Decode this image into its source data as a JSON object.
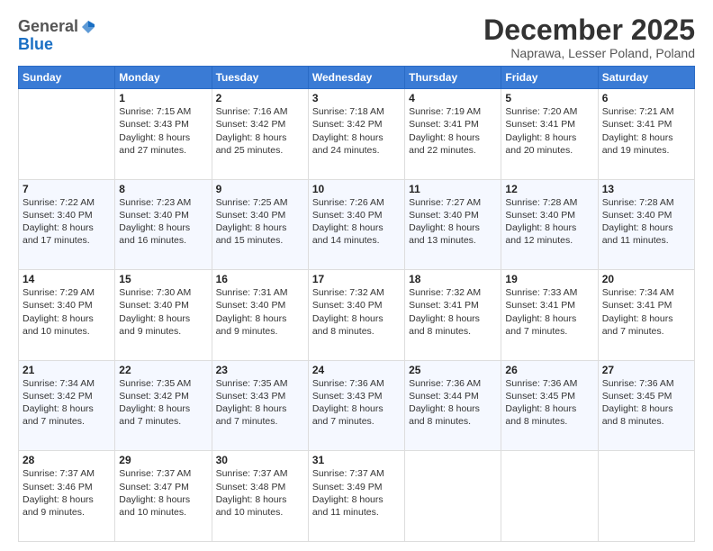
{
  "header": {
    "logo_general": "General",
    "logo_blue": "Blue",
    "month_title": "December 2025",
    "location": "Naprawa, Lesser Poland, Poland"
  },
  "weekdays": [
    "Sunday",
    "Monday",
    "Tuesday",
    "Wednesday",
    "Thursday",
    "Friday",
    "Saturday"
  ],
  "rows": [
    [
      {
        "day": "",
        "sunrise": "",
        "sunset": "",
        "daylight": ""
      },
      {
        "day": "1",
        "sunrise": "Sunrise: 7:15 AM",
        "sunset": "Sunset: 3:43 PM",
        "daylight": "Daylight: 8 hours and 27 minutes."
      },
      {
        "day": "2",
        "sunrise": "Sunrise: 7:16 AM",
        "sunset": "Sunset: 3:42 PM",
        "daylight": "Daylight: 8 hours and 25 minutes."
      },
      {
        "day": "3",
        "sunrise": "Sunrise: 7:18 AM",
        "sunset": "Sunset: 3:42 PM",
        "daylight": "Daylight: 8 hours and 24 minutes."
      },
      {
        "day": "4",
        "sunrise": "Sunrise: 7:19 AM",
        "sunset": "Sunset: 3:41 PM",
        "daylight": "Daylight: 8 hours and 22 minutes."
      },
      {
        "day": "5",
        "sunrise": "Sunrise: 7:20 AM",
        "sunset": "Sunset: 3:41 PM",
        "daylight": "Daylight: 8 hours and 20 minutes."
      },
      {
        "day": "6",
        "sunrise": "Sunrise: 7:21 AM",
        "sunset": "Sunset: 3:41 PM",
        "daylight": "Daylight: 8 hours and 19 minutes."
      }
    ],
    [
      {
        "day": "7",
        "sunrise": "Sunrise: 7:22 AM",
        "sunset": "Sunset: 3:40 PM",
        "daylight": "Daylight: 8 hours and 17 minutes."
      },
      {
        "day": "8",
        "sunrise": "Sunrise: 7:23 AM",
        "sunset": "Sunset: 3:40 PM",
        "daylight": "Daylight: 8 hours and 16 minutes."
      },
      {
        "day": "9",
        "sunrise": "Sunrise: 7:25 AM",
        "sunset": "Sunset: 3:40 PM",
        "daylight": "Daylight: 8 hours and 15 minutes."
      },
      {
        "day": "10",
        "sunrise": "Sunrise: 7:26 AM",
        "sunset": "Sunset: 3:40 PM",
        "daylight": "Daylight: 8 hours and 14 minutes."
      },
      {
        "day": "11",
        "sunrise": "Sunrise: 7:27 AM",
        "sunset": "Sunset: 3:40 PM",
        "daylight": "Daylight: 8 hours and 13 minutes."
      },
      {
        "day": "12",
        "sunrise": "Sunrise: 7:28 AM",
        "sunset": "Sunset: 3:40 PM",
        "daylight": "Daylight: 8 hours and 12 minutes."
      },
      {
        "day": "13",
        "sunrise": "Sunrise: 7:28 AM",
        "sunset": "Sunset: 3:40 PM",
        "daylight": "Daylight: 8 hours and 11 minutes."
      }
    ],
    [
      {
        "day": "14",
        "sunrise": "Sunrise: 7:29 AM",
        "sunset": "Sunset: 3:40 PM",
        "daylight": "Daylight: 8 hours and 10 minutes."
      },
      {
        "day": "15",
        "sunrise": "Sunrise: 7:30 AM",
        "sunset": "Sunset: 3:40 PM",
        "daylight": "Daylight: 8 hours and 9 minutes."
      },
      {
        "day": "16",
        "sunrise": "Sunrise: 7:31 AM",
        "sunset": "Sunset: 3:40 PM",
        "daylight": "Daylight: 8 hours and 9 minutes."
      },
      {
        "day": "17",
        "sunrise": "Sunrise: 7:32 AM",
        "sunset": "Sunset: 3:40 PM",
        "daylight": "Daylight: 8 hours and 8 minutes."
      },
      {
        "day": "18",
        "sunrise": "Sunrise: 7:32 AM",
        "sunset": "Sunset: 3:41 PM",
        "daylight": "Daylight: 8 hours and 8 minutes."
      },
      {
        "day": "19",
        "sunrise": "Sunrise: 7:33 AM",
        "sunset": "Sunset: 3:41 PM",
        "daylight": "Daylight: 8 hours and 7 minutes."
      },
      {
        "day": "20",
        "sunrise": "Sunrise: 7:34 AM",
        "sunset": "Sunset: 3:41 PM",
        "daylight": "Daylight: 8 hours and 7 minutes."
      }
    ],
    [
      {
        "day": "21",
        "sunrise": "Sunrise: 7:34 AM",
        "sunset": "Sunset: 3:42 PM",
        "daylight": "Daylight: 8 hours and 7 minutes."
      },
      {
        "day": "22",
        "sunrise": "Sunrise: 7:35 AM",
        "sunset": "Sunset: 3:42 PM",
        "daylight": "Daylight: 8 hours and 7 minutes."
      },
      {
        "day": "23",
        "sunrise": "Sunrise: 7:35 AM",
        "sunset": "Sunset: 3:43 PM",
        "daylight": "Daylight: 8 hours and 7 minutes."
      },
      {
        "day": "24",
        "sunrise": "Sunrise: 7:36 AM",
        "sunset": "Sunset: 3:43 PM",
        "daylight": "Daylight: 8 hours and 7 minutes."
      },
      {
        "day": "25",
        "sunrise": "Sunrise: 7:36 AM",
        "sunset": "Sunset: 3:44 PM",
        "daylight": "Daylight: 8 hours and 8 minutes."
      },
      {
        "day": "26",
        "sunrise": "Sunrise: 7:36 AM",
        "sunset": "Sunset: 3:45 PM",
        "daylight": "Daylight: 8 hours and 8 minutes."
      },
      {
        "day": "27",
        "sunrise": "Sunrise: 7:36 AM",
        "sunset": "Sunset: 3:45 PM",
        "daylight": "Daylight: 8 hours and 8 minutes."
      }
    ],
    [
      {
        "day": "28",
        "sunrise": "Sunrise: 7:37 AM",
        "sunset": "Sunset: 3:46 PM",
        "daylight": "Daylight: 8 hours and 9 minutes."
      },
      {
        "day": "29",
        "sunrise": "Sunrise: 7:37 AM",
        "sunset": "Sunset: 3:47 PM",
        "daylight": "Daylight: 8 hours and 10 minutes."
      },
      {
        "day": "30",
        "sunrise": "Sunrise: 7:37 AM",
        "sunset": "Sunset: 3:48 PM",
        "daylight": "Daylight: 8 hours and 10 minutes."
      },
      {
        "day": "31",
        "sunrise": "Sunrise: 7:37 AM",
        "sunset": "Sunset: 3:49 PM",
        "daylight": "Daylight: 8 hours and 11 minutes."
      },
      {
        "day": "",
        "sunrise": "",
        "sunset": "",
        "daylight": ""
      },
      {
        "day": "",
        "sunrise": "",
        "sunset": "",
        "daylight": ""
      },
      {
        "day": "",
        "sunrise": "",
        "sunset": "",
        "daylight": ""
      }
    ]
  ]
}
